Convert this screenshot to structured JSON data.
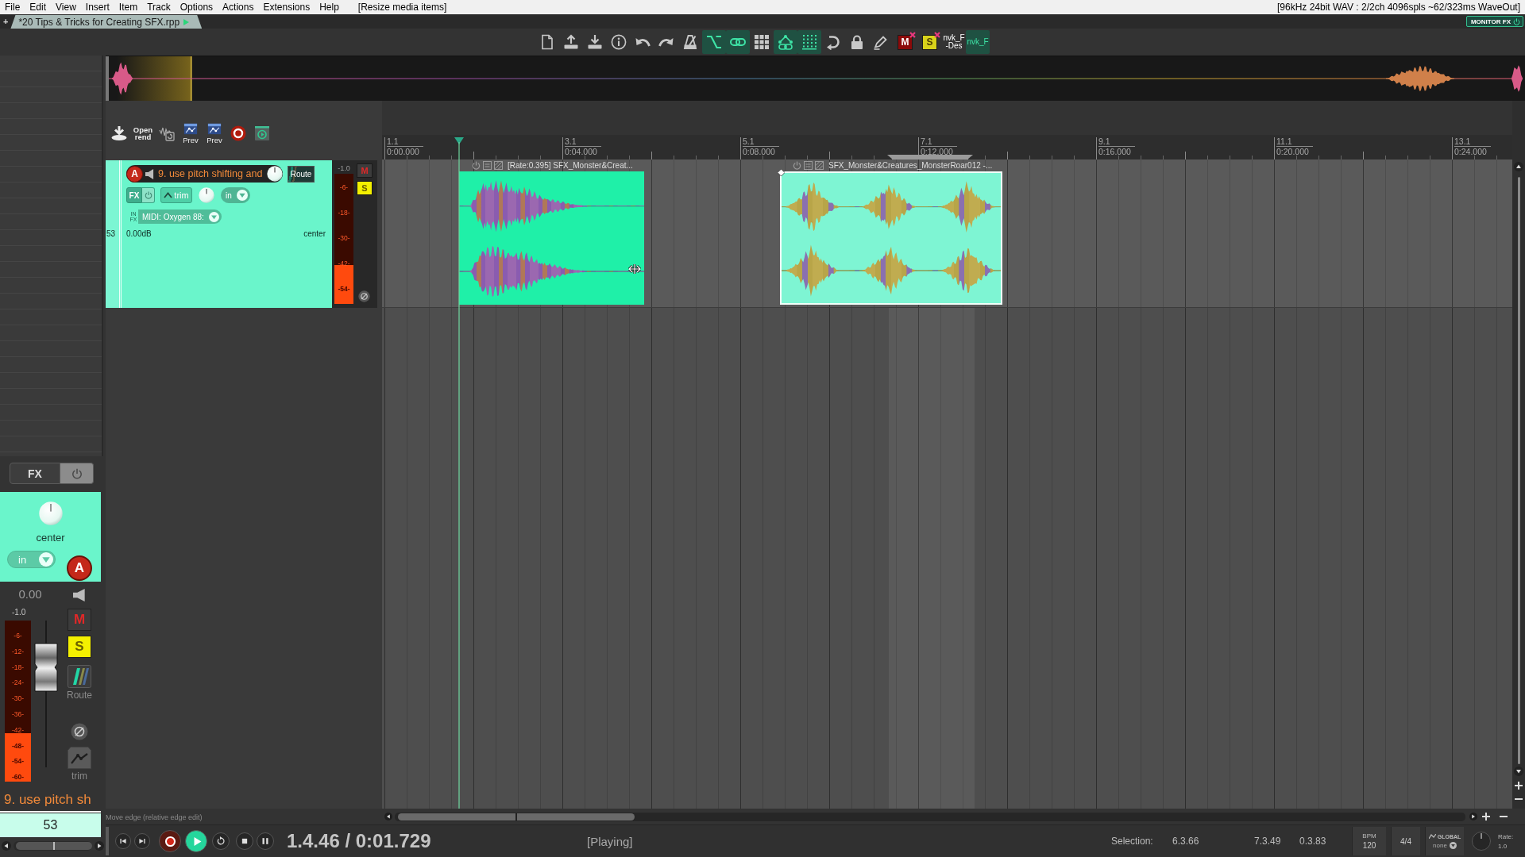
{
  "menu_bar": {
    "menus": [
      "File",
      "Edit",
      "View",
      "Insert",
      "Item",
      "Track",
      "Options",
      "Actions",
      "Extensions",
      "Help"
    ],
    "action_hint": "[Resize media items]",
    "device_status": "[96kHz 24bit WAV : 2/2ch 4096spls ~62/323ms WaveOut]"
  },
  "tab_bar": {
    "new_tab": "+",
    "tabs": [
      {
        "label": "*20 Tips & Tricks for Creating SFX.rpp",
        "selected": true
      }
    ],
    "monitor_fx": "MONITOR FX"
  },
  "main_toolbar": {
    "buttons": [
      {
        "kind": "icon",
        "on": false
      },
      {
        "kind": "icon",
        "on": false
      },
      {
        "kind": "icon",
        "on": false
      },
      {
        "kind": "icon",
        "on": false
      },
      {
        "kind": "icon",
        "on": false
      },
      {
        "kind": "icon",
        "on": false
      },
      {
        "kind": "icon",
        "on": false
      },
      {
        "kind": "icon",
        "on": true
      },
      {
        "kind": "icon",
        "on": true
      },
      {
        "kind": "icon",
        "on": false
      },
      {
        "kind": "icon",
        "on": true
      },
      {
        "kind": "icon",
        "on": true
      },
      {
        "kind": "icon",
        "on": false
      },
      {
        "kind": "icon",
        "on": false
      },
      {
        "kind": "icon",
        "on": false
      },
      {
        "kind": "letter",
        "label": "M",
        "color": "#8b0a0a",
        "on": false
      },
      {
        "kind": "letter",
        "label": "S",
        "color": "#d8d21a",
        "on": false
      },
      {
        "kind": "text",
        "label": "nvk_F -Des",
        "on": false
      },
      {
        "kind": "text",
        "label": "nvk_F",
        "on": true
      }
    ]
  },
  "tcp_toolbar": {
    "buttons": [
      {
        "kind": "icon"
      },
      {
        "kind": "text",
        "label": "Open rend"
      },
      {
        "kind": "icon"
      },
      {
        "kind": "icon_label",
        "label": "Prev"
      },
      {
        "kind": "icon_label",
        "label": "Prev"
      },
      {
        "kind": "icon"
      },
      {
        "kind": "icon"
      }
    ]
  },
  "track": {
    "number": "53",
    "arm": {
      "label": "A",
      "on": true
    },
    "name": "9. use pitch shifting and",
    "route": "Route",
    "fx": "FX",
    "trim": "trim",
    "input": "in",
    "input_fx_label": "IN FX",
    "midi_input": "MIDI: Oxygen 88:",
    "volume": "0.00dB",
    "pan": "center",
    "meter": {
      "peak": "-1.0",
      "scale": [
        "-6-",
        "-18-",
        "-30-",
        "-42-",
        "-54-"
      ],
      "level": 0.3
    },
    "mute": {
      "label": "M",
      "on": false
    },
    "solo": {
      "label": "S",
      "on": true
    }
  },
  "arrange": {
    "ruler": [
      {
        "bar": "1.1",
        "time": "0:00.000"
      },
      {
        "bar": "3.1",
        "time": "0:04.000"
      },
      {
        "bar": "5.1",
        "time": "0:08.000"
      },
      {
        "bar": "7.1",
        "time": "0:12.000"
      },
      {
        "bar": "9.1",
        "time": "0:16.000"
      },
      {
        "bar": "11.1",
        "time": "0:20.000"
      },
      {
        "bar": "13.1",
        "time": "0:24.000"
      }
    ],
    "items": [
      {
        "label": "[Rate:0.395] SFX_Monster&Creat...",
        "selected": false
      },
      {
        "label": "SFX_Monster&Creatures_MonsterRoar012 -...",
        "selected": true
      }
    ]
  },
  "mixer_strip": {
    "fx": "FX",
    "pan": "center",
    "input": "in",
    "arm": {
      "label": "A",
      "on": true
    },
    "volume": "0.00",
    "meter": {
      "peak": "-1.0",
      "scale": [
        "-6-",
        "-12-",
        "-18-",
        "-24-",
        "-30-",
        "-36-",
        "-42-",
        "-48-",
        "-54-",
        "-60-"
      ],
      "level": 0.3
    },
    "fader": {
      "level": 0.68
    },
    "mute": {
      "label": "M",
      "on": false
    },
    "solo": {
      "label": "S",
      "on": true
    },
    "route": "Route",
    "trim": "trim",
    "name": "9. use pitch sh",
    "number": "53"
  },
  "status_bar": {
    "hint": "Move edge (relative edge edit)"
  },
  "transport": {
    "buttons": [
      {
        "on": false
      },
      {
        "on": false
      },
      {
        "on": false
      },
      {
        "on": true
      },
      {
        "on": false
      },
      {
        "on": false
      },
      {
        "on": false
      }
    ],
    "position": "1.4.46 / 0:01.729",
    "state": "[Playing]",
    "selection_label": "Selection:",
    "selection_start": "6.3.66",
    "selection_end": "7.3.49",
    "selection_length": "0.3.83",
    "bpm_label": "BPM",
    "bpm": "120",
    "time_signature": "4/4",
    "playrate_mode": "GLOBAL",
    "playrate_option": "none",
    "rate_label": "Rate:",
    "rate": "1.0"
  }
}
